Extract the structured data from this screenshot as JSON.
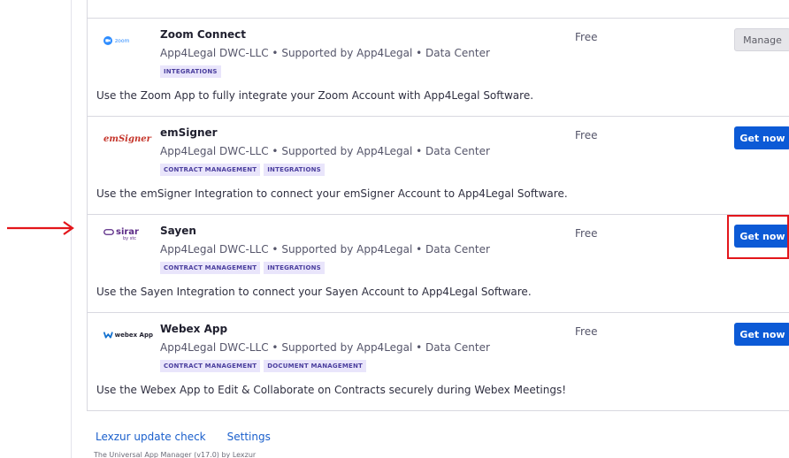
{
  "apps": [
    {
      "name": "Zoom Connect",
      "logo_text": "zoom",
      "meta": "App4Legal DWC-LLC • Supported by App4Legal • Data Center",
      "tags": [
        "INTEGRATIONS"
      ],
      "description": "Use the Zoom App to fully integrate your Zoom Account with App4Legal Software.",
      "price": "Free",
      "action": "Manage"
    },
    {
      "name": "emSigner",
      "logo_text": "emSigner",
      "meta": "App4Legal DWC-LLC • Supported by App4Legal • Data Center",
      "tags": [
        "CONTRACT MANAGEMENT",
        "INTEGRATIONS"
      ],
      "description": "Use the emSigner Integration to connect your emSigner Account to App4Legal Software.",
      "price": "Free",
      "action": "Get now"
    },
    {
      "name": "Sayen",
      "logo_text": "sirar",
      "logo_subtext": "by stc",
      "meta": "App4Legal DWC-LLC • Supported by App4Legal • Data Center",
      "tags": [
        "CONTRACT MANAGEMENT",
        "INTEGRATIONS"
      ],
      "description": "Use the Sayen Integration to connect your Sayen Account to App4Legal Software.",
      "price": "Free",
      "action": "Get now"
    },
    {
      "name": "Webex App",
      "logo_text": "webex App",
      "meta": "App4Legal DWC-LLC • Supported by App4Legal • Data Center",
      "tags": [
        "CONTRACT MANAGEMENT",
        "DOCUMENT MANAGEMENT"
      ],
      "description": "Use the Webex App to Edit & Collaborate on Contracts securely during Webex Meetings!",
      "price": "Free",
      "action": "Get now"
    }
  ],
  "footer": {
    "update_check": "Lexzur update check",
    "settings": "Settings",
    "credit": "The Universal App Manager (v17.0) by Lexzur"
  },
  "colors": {
    "primary_button": "#0c5ad6",
    "tag_bg": "#e9e5fb",
    "tag_text": "#4b3f9e",
    "annotation_red": "#e3161b",
    "link": "#1a5fcc"
  }
}
